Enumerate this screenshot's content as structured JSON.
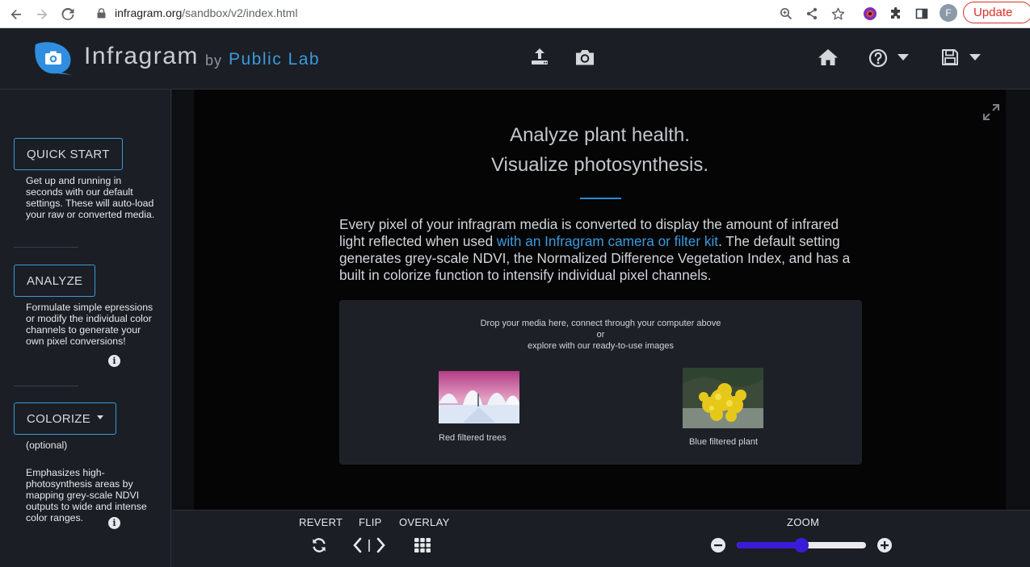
{
  "browser": {
    "url_host": "infragram.org",
    "url_path": "/sandbox/v2/index.html",
    "profile_initial": "F",
    "update_label": "Update"
  },
  "header": {
    "brand": "Infragram",
    "by": "by",
    "org": "Public Lab",
    "icons": [
      "upload-icon",
      "camera-icon",
      "home-icon",
      "help-icon",
      "save-icon"
    ]
  },
  "sidebar": {
    "quick_start": {
      "label": "QUICK START",
      "desc": "Get up and running in seconds with our default settings. These will auto-load your raw or converted media."
    },
    "analyze": {
      "label": "ANALYZE",
      "desc": "Formulate simple epressions or modify the individual color channels to generate your own pixel conversions!"
    },
    "colorize": {
      "label": "COLORIZE",
      "optional": "(optional)",
      "desc": "Emphasizes high-photosynthesis areas by mapping grey-scale NDVI outputs to wide and intense color ranges."
    }
  },
  "main": {
    "headline1": "Analyze plant health.",
    "headline2": "Visualize photosynthesis.",
    "lede_before": "Every pixel of your infragram media is converted to display the amount of infrared light reflected when used ",
    "lede_link": "with an Infragram camera or filter kit",
    "lede_after": ". The default setting generates grey-scale NDVI, the Normalized Difference Vegetation Index, and has a built in colorize function to intensify individual pixel channels.",
    "drop_line1": "Drop your media here, connect through your computer above",
    "drop_line2": "or",
    "drop_line3": "explore with our ready-to-use images",
    "samples": [
      {
        "caption": "Red filtered trees"
      },
      {
        "caption": "Blue filtered plant"
      }
    ]
  },
  "toolbar": {
    "revert": "REVERT",
    "flip": "FLIP",
    "overlay": "OVERLAY",
    "zoom": "ZOOM",
    "zoom_level": 0.5
  },
  "colors": {
    "accent": "#3a9bdc",
    "slider": "#3a1bd8",
    "bg": "#1b1e24"
  }
}
